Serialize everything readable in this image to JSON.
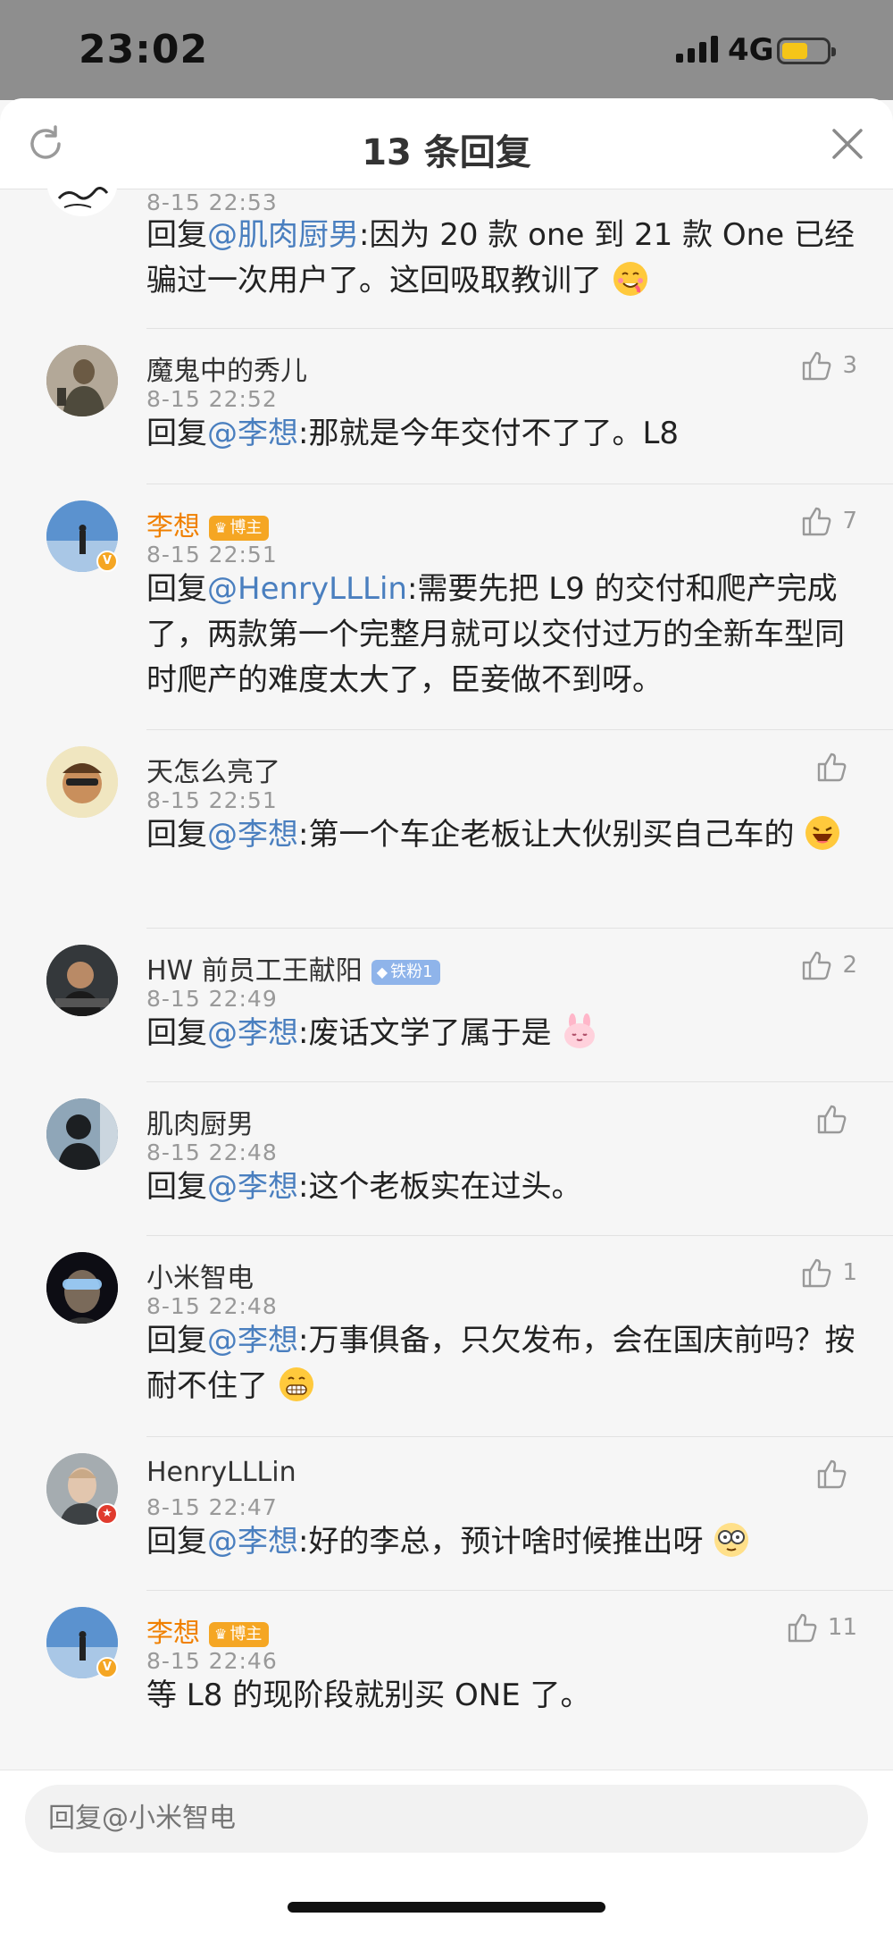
{
  "status_bar": {
    "time": "23:02",
    "network": "4G"
  },
  "header": {
    "title": "13 条回复"
  },
  "comments": [
    {
      "name": "",
      "time": "8-15 22:53",
      "reply_prefix": "回复",
      "mention": "@肌肉厨男",
      "text": ":因为 20 款 one 到 21 款 One 已经骗过一次用户了。这回吸取教训了",
      "likes": ""
    },
    {
      "name": "魔鬼中的秀儿",
      "time": "8-15 22:52",
      "reply_prefix": "回复",
      "mention": "@李想",
      "text": ":那就是今年交付不了了。L8",
      "likes": "3"
    },
    {
      "name": "李想",
      "badge": "博主",
      "time": "8-15 22:51",
      "reply_prefix": "回复",
      "mention": "@HenryLLLin",
      "text": ":需要先把 L9 的交付和爬产完成了，两款第一个完整月就可以交付过万的全新车型同时爬产的难度太大了，臣妾做不到呀。",
      "likes": "7"
    },
    {
      "name": "天怎么亮了",
      "time": "8-15 22:51",
      "reply_prefix": "回复",
      "mention": "@李想",
      "text": ":第一个车企老板让大伙别买自己车的",
      "likes": ""
    },
    {
      "name": "HW 前员工王献阳",
      "badge": "铁粉1",
      "time": "8-15 22:49",
      "reply_prefix": "回复",
      "mention": "@李想",
      "text": ":废话文学了属于是",
      "likes": "2"
    },
    {
      "name": "肌肉厨男",
      "time": "8-15 22:48",
      "reply_prefix": "回复",
      "mention": "@李想",
      "text": ":这个老板实在过头。",
      "likes": ""
    },
    {
      "name": "小米智电",
      "time": "8-15 22:48",
      "reply_prefix": "回复",
      "mention": "@李想",
      "text": ":万事俱备，只欠发布，会在国庆前吗？按耐不住了",
      "likes": "1"
    },
    {
      "name": "HenryLLLin",
      "time": "8-15 22:47",
      "reply_prefix": "回复",
      "mention": "@李想",
      "text": ":好的李总，预计啥时候推出呀",
      "likes": ""
    },
    {
      "name": "李想",
      "badge": "博主",
      "time": "8-15 22:46",
      "reply_prefix": "",
      "mention": "",
      "text": "等 L8 的现阶段就别买 ONE 了。",
      "likes": "11"
    }
  ],
  "reply_bar": {
    "placeholder": "回复@小米智电"
  },
  "colors": {
    "mention": "#4a7fbf",
    "author_name": "#f08000",
    "blogger_badge": "#f5a623",
    "fan_badge": "#8fb4ea"
  }
}
